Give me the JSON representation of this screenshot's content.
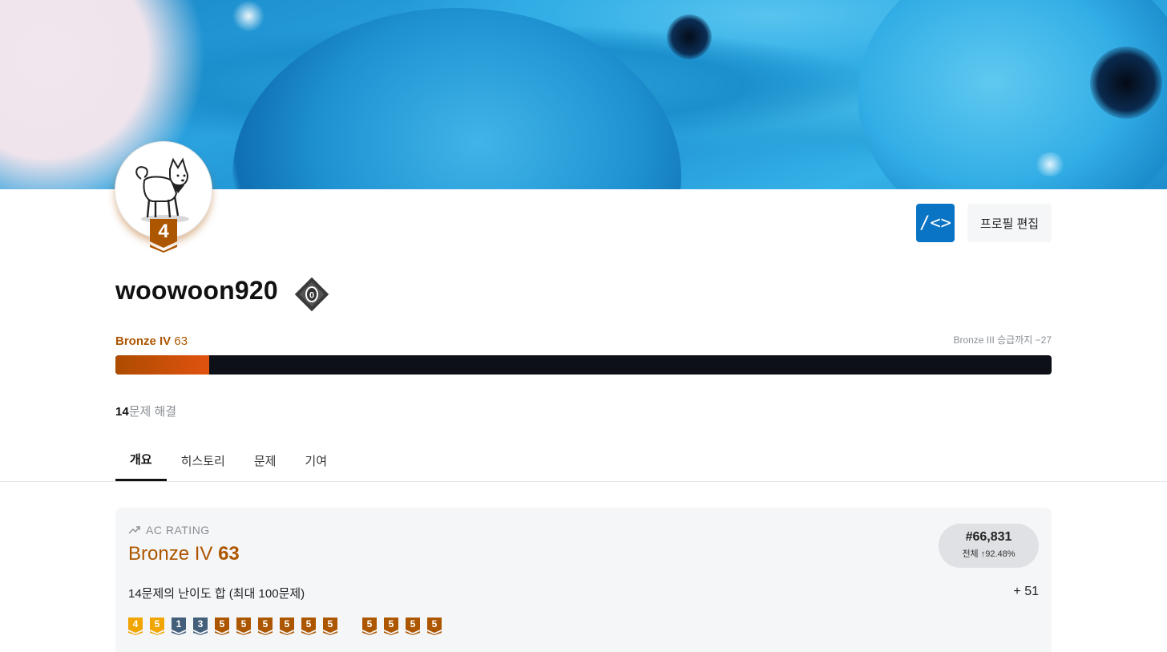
{
  "profile": {
    "username": "woowoon920",
    "tier_level_badge": "4",
    "class_badge": "0",
    "edit_button": "프로필 편집",
    "ojs_button": "/<>"
  },
  "rating": {
    "tier_name": "Bronze IV",
    "rating_value": "63",
    "next_tier_text": "Bronze III 승급까지 −27",
    "progress_fraction": 0.1,
    "colors": {
      "bronze": "#ad5600",
      "progress_start": "#ad4c00",
      "progress_end": "#e0520f",
      "track": "#0d1117"
    }
  },
  "solved": {
    "count": "14",
    "suffix": "문제 해결"
  },
  "tabs": [
    {
      "label": "개요",
      "active": true
    },
    {
      "label": "히스토리",
      "active": false
    },
    {
      "label": "문제",
      "active": false
    },
    {
      "label": "기여",
      "active": false
    }
  ],
  "ac_rating": {
    "label": "AC RATING",
    "icon": "trending-up-icon",
    "tier_name": "Bronze IV",
    "rating_value": "63",
    "rank": "#66,831",
    "rank_detail": "전체 ↑92.48%",
    "sum_label": "14문제의 난이도 합 (최대 100문제)",
    "sum_value": "+ 51",
    "problem_tiers": [
      {
        "num": "4",
        "color": "#f0a500"
      },
      {
        "num": "5",
        "color": "#f0a500"
      },
      {
        "num": "1",
        "color": "#435f7a"
      },
      {
        "num": "3",
        "color": "#435f7a"
      },
      {
        "num": "5",
        "color": "#ad5600"
      },
      {
        "num": "5",
        "color": "#ad5600"
      },
      {
        "num": "5",
        "color": "#ad5600"
      },
      {
        "num": "5",
        "color": "#ad5600"
      },
      {
        "num": "5",
        "color": "#ad5600"
      },
      {
        "num": "5",
        "color": "#ad5600"
      },
      {
        "num": "5",
        "color": "#ad5600"
      },
      {
        "num": "5",
        "color": "#ad5600"
      },
      {
        "num": "5",
        "color": "#ad5600"
      },
      {
        "num": "5",
        "color": "#ad5600"
      }
    ]
  }
}
